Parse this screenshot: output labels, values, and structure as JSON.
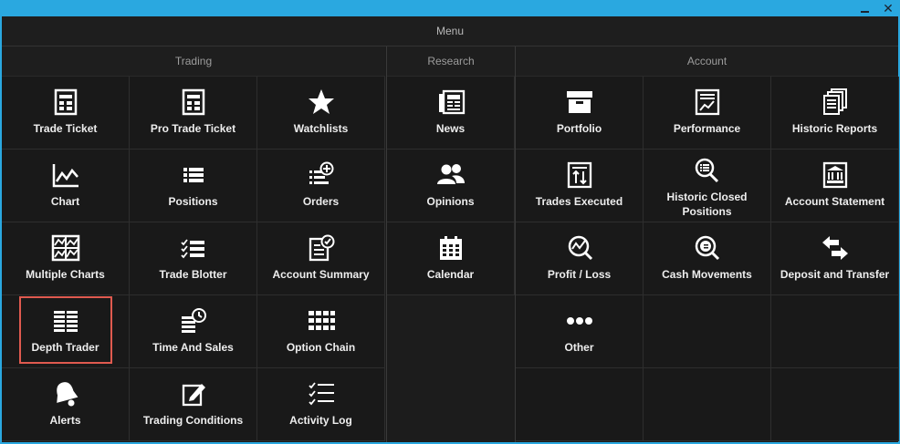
{
  "window": {
    "minimize_glyph": "",
    "close_glyph": "✕"
  },
  "menu_title": "Menu",
  "sections": {
    "trading": {
      "title": "Trading",
      "items": [
        {
          "label": "Trade Ticket",
          "icon": "trade-ticket-icon"
        },
        {
          "label": "Pro Trade Ticket",
          "icon": "pro-trade-ticket-icon"
        },
        {
          "label": "Watchlists",
          "icon": "star-icon"
        },
        {
          "label": "Chart",
          "icon": "line-chart-icon"
        },
        {
          "label": "Positions",
          "icon": "list-icon"
        },
        {
          "label": "Orders",
          "icon": "orders-add-icon"
        },
        {
          "label": "Multiple Charts",
          "icon": "multiple-charts-icon"
        },
        {
          "label": "Trade Blotter",
          "icon": "checklist-icon"
        },
        {
          "label": "Account Summary",
          "icon": "account-summary-icon"
        },
        {
          "label": "Depth Trader",
          "icon": "depth-grid-icon"
        },
        {
          "label": "Time And Sales",
          "icon": "time-sales-icon"
        },
        {
          "label": "Option Chain",
          "icon": "option-chain-icon"
        },
        {
          "label": "Alerts",
          "icon": "bell-icon"
        },
        {
          "label": "Trading Conditions",
          "icon": "edit-icon"
        },
        {
          "label": "Activity Log",
          "icon": "activity-log-icon"
        }
      ]
    },
    "research": {
      "title": "Research",
      "items": [
        {
          "label": "News",
          "icon": "newspaper-icon"
        },
        {
          "label": "Opinions",
          "icon": "users-icon"
        },
        {
          "label": "Calendar",
          "icon": "calendar-icon"
        }
      ]
    },
    "account": {
      "title": "Account",
      "items": [
        {
          "label": "Portfolio",
          "icon": "portfolio-icon"
        },
        {
          "label": "Performance",
          "icon": "performance-icon"
        },
        {
          "label": "Historic Reports",
          "icon": "historic-reports-icon"
        },
        {
          "label": "Trades Executed",
          "icon": "trades-executed-icon"
        },
        {
          "label": "Historic Closed Positions",
          "icon": "search-list-icon"
        },
        {
          "label": "Account Statement",
          "icon": "bank-icon"
        },
        {
          "label": "Profit / Loss",
          "icon": "profit-loss-icon"
        },
        {
          "label": "Cash Movements",
          "icon": "cash-search-icon"
        },
        {
          "label": "Deposit and Transfer",
          "icon": "transfer-arrows-icon"
        },
        {
          "label": "Other",
          "icon": "more-dots-icon"
        }
      ]
    }
  },
  "selected_item": "Depth Trader",
  "colors": {
    "frame": "#2aa8e0",
    "background": "#1c1c1c",
    "selection": "#e05a4f"
  }
}
